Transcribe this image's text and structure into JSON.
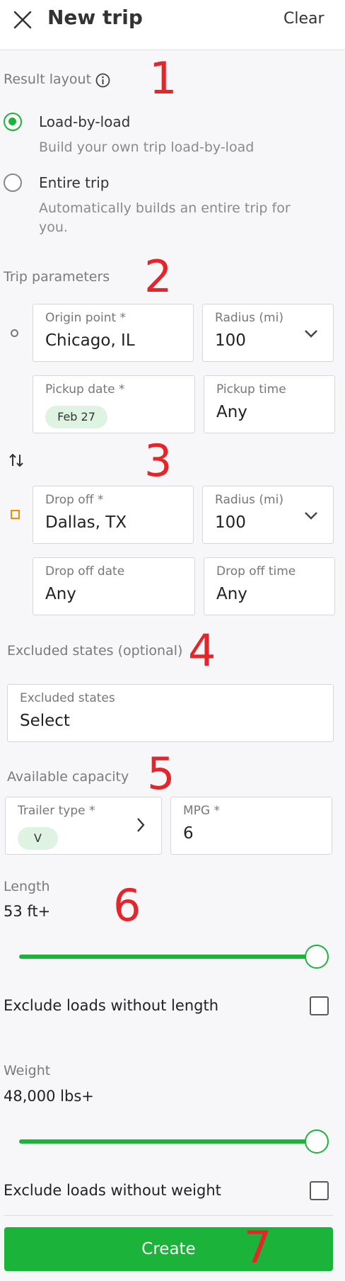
{
  "header": {
    "title": "New trip",
    "clear_label": "Clear"
  },
  "markers": [
    "1",
    "2",
    "3",
    "4",
    "5",
    "6",
    "7"
  ],
  "result_layout": {
    "label": "Result layout",
    "options": [
      {
        "title": "Load-by-load",
        "description": "Build your own trip load-by-load",
        "selected": true
      },
      {
        "title": "Entire trip",
        "description_line1": "Automatically builds an entire trip for",
        "description_line2": "you.",
        "selected": false
      }
    ]
  },
  "trip_parameters": {
    "label": "Trip parameters",
    "origin": {
      "label": "Origin point *",
      "value": "Chicago, IL"
    },
    "origin_radius": {
      "label": "Radius (mi)",
      "value": "100"
    },
    "pickup_date": {
      "label": "Pickup date *",
      "chip": "Feb 27"
    },
    "pickup_time": {
      "label": "Pickup time",
      "value": "Any"
    },
    "dropoff": {
      "label": "Drop off *",
      "value": "Dallas, TX"
    },
    "dropoff_radius": {
      "label": "Radius (mi)",
      "value": "100"
    },
    "dropoff_date": {
      "label": "Drop off date",
      "value": "Any"
    },
    "dropoff_time": {
      "label": "Drop off time",
      "value": "Any"
    }
  },
  "excluded_states": {
    "label": "Excluded states (optional)",
    "field_label": "Excluded states",
    "value": "Select"
  },
  "capacity": {
    "label": "Available capacity",
    "trailer_type": {
      "label": "Trailer type *",
      "chip": "V"
    },
    "mpg": {
      "label": "MPG *",
      "value": "6"
    }
  },
  "length": {
    "label": "Length",
    "value": "53 ft+",
    "slider_fraction": 1.0,
    "exclude_label": "Exclude loads without length",
    "exclude_checked": false
  },
  "weight": {
    "label": "Weight",
    "value": "48,000 lbs+",
    "slider_fraction": 1.0,
    "exclude_label": "Exclude loads without weight",
    "exclude_checked": false
  },
  "create_label": "Create",
  "colors": {
    "accent": "#1bb33a",
    "marker": "#e5252a",
    "destination": "#f08c00"
  }
}
